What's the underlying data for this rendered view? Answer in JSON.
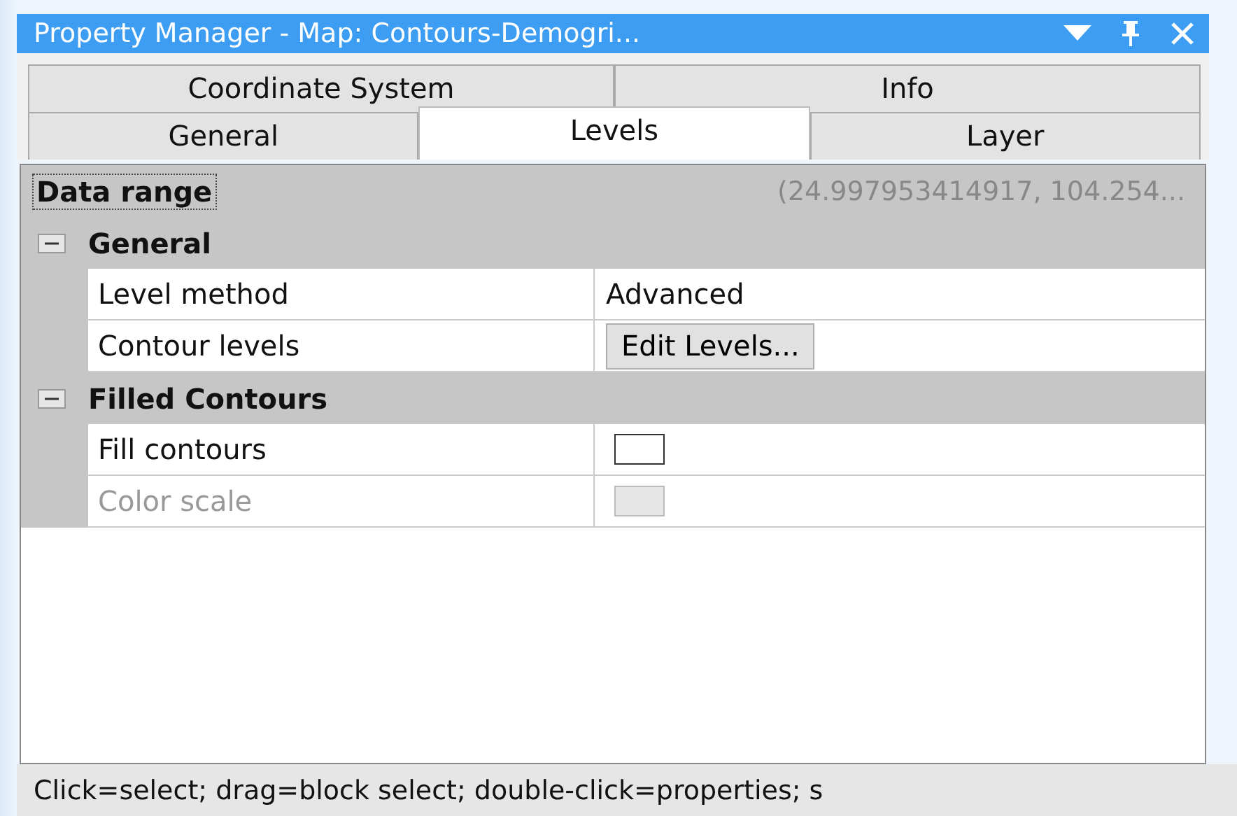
{
  "window": {
    "title": "Property Manager - Map: Contours-Demogri..."
  },
  "tab_rows": [
    [
      {
        "label": "Coordinate System",
        "selected": false
      },
      {
        "label": "Info",
        "selected": false
      }
    ],
    [
      {
        "label": "General",
        "selected": false
      },
      {
        "label": "Levels",
        "selected": true
      },
      {
        "label": "Layer",
        "selected": false
      }
    ]
  ],
  "grid": {
    "header": {
      "label": "Data range",
      "value": "(24.997953414917, 104.254..."
    },
    "categories": [
      {
        "name": "General",
        "expanded": true,
        "properties": [
          {
            "name": "Level method",
            "kind": "text",
            "value": "Advanced",
            "disabled": false
          },
          {
            "name": "Contour levels",
            "kind": "button",
            "value": "Edit Levels...",
            "disabled": false
          }
        ]
      },
      {
        "name": "Filled Contours",
        "expanded": true,
        "properties": [
          {
            "name": "Fill contours",
            "kind": "checkbox",
            "checked": false,
            "disabled": false
          },
          {
            "name": "Color scale",
            "kind": "checkbox",
            "checked": false,
            "disabled": true
          }
        ]
      }
    ]
  },
  "status_bar": "Click=select; drag=block select; double-click=properties; s"
}
